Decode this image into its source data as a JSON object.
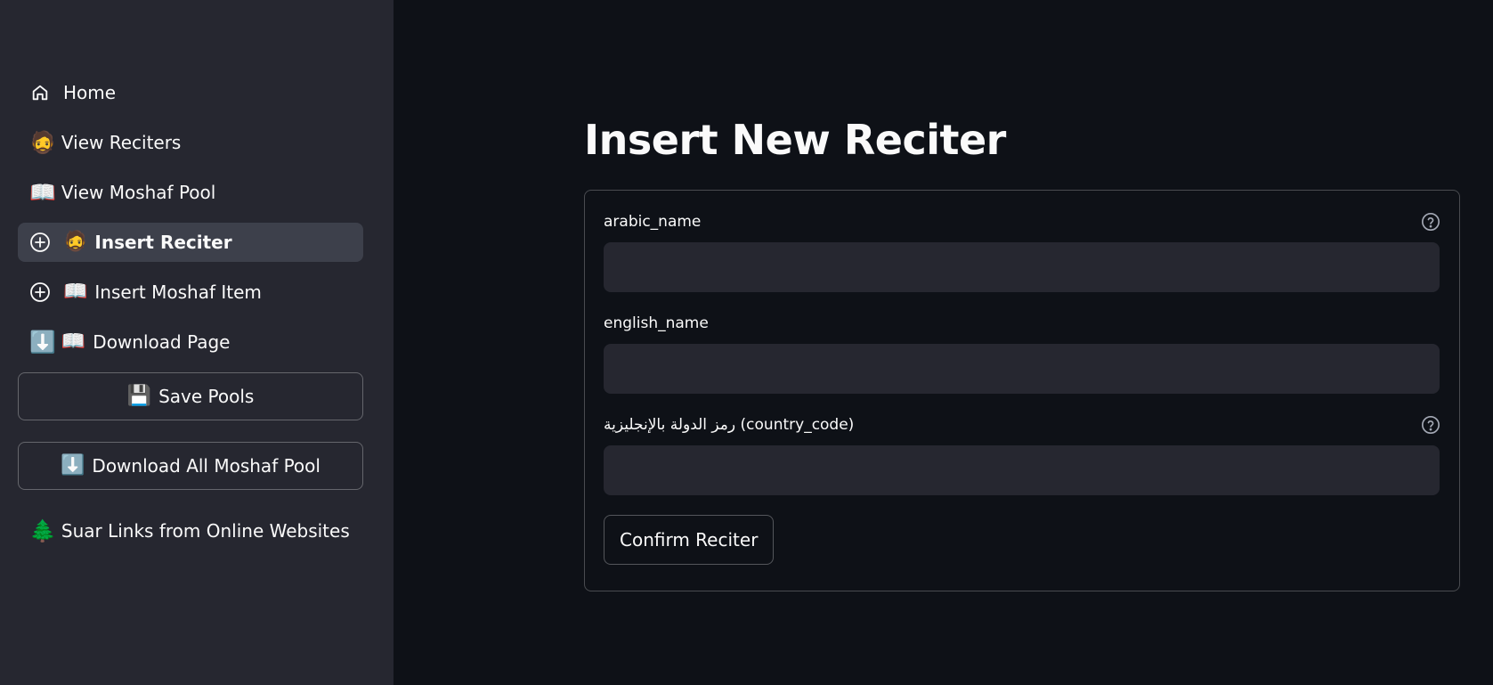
{
  "sidebar": {
    "items": [
      {
        "label": "Home",
        "icon": "home-icon"
      },
      {
        "label": "View Reciters",
        "emoji": "🧔"
      },
      {
        "label": "View Moshaf Pool",
        "emoji": "📖"
      },
      {
        "label": "Insert Reciter",
        "icon": "plus-circle-icon",
        "emoji": "🧔",
        "active": true
      },
      {
        "label": "Insert Moshaf Item",
        "icon": "plus-circle-icon",
        "emoji": "📖"
      },
      {
        "label": "Download Page",
        "emoji_lead": "⬇️",
        "emoji": "📖"
      }
    ],
    "save_pools": {
      "emoji": "💾",
      "label": "Save Pools"
    },
    "download_all": {
      "emoji": "⬇️",
      "label": "Download All Moshaf Pool"
    },
    "suar_links": {
      "emoji": "🌲",
      "label": "Suar Links from Online Websites"
    }
  },
  "main": {
    "title": "Insert New Reciter",
    "fields": [
      {
        "label": "arabic_name",
        "value": "",
        "has_help": true
      },
      {
        "label": "english_name",
        "value": "",
        "has_help": false
      },
      {
        "label": "رمز الدولة بالإنجليزية (country_code)",
        "value": "",
        "has_help": true
      }
    ],
    "confirm_label": "Confirm Reciter"
  },
  "colors": {
    "background": "#0e1117",
    "sidebar": "#262730",
    "active_item": "#3d404b",
    "input": "#262730",
    "text": "#fafafa"
  }
}
